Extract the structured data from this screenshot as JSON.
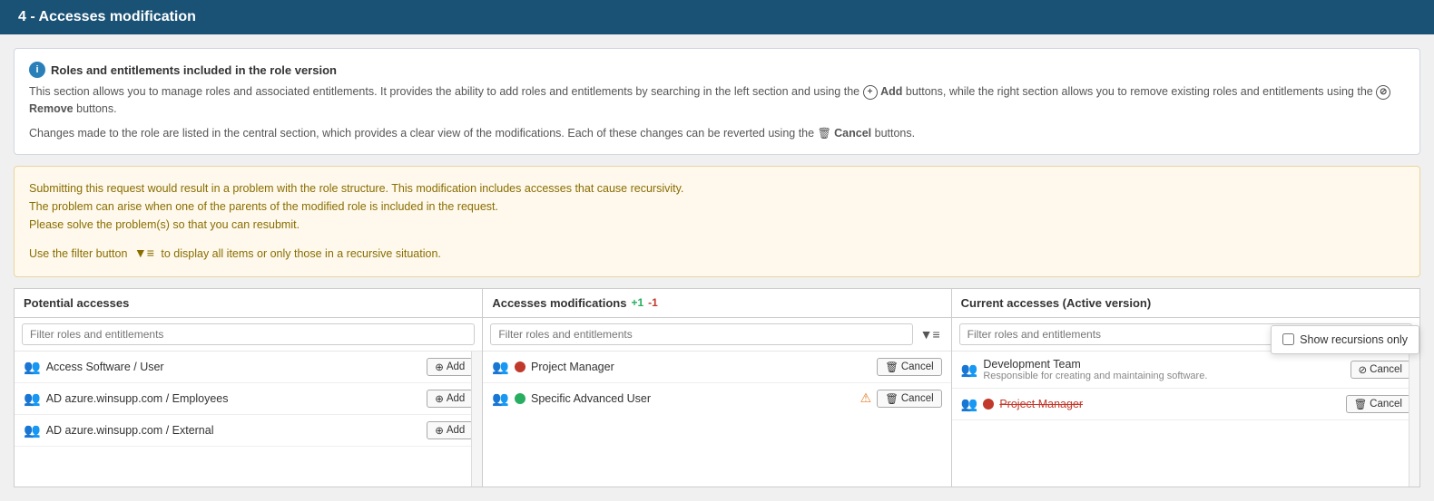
{
  "header": {
    "title": "4 - Accesses modification"
  },
  "info_box": {
    "title": "Roles and entitlements included in the role version",
    "line1": "This section allows you to manage roles and associated entitlements. It provides the ability to add roles and entitlements by searching in the left section and using the",
    "add_label": "Add",
    "line2": "buttons, while the right section allows you to remove existing roles and entitlements using the",
    "remove_label": "Remove",
    "line3": "buttons.",
    "line4": "Changes made to the role are listed in the central section, which provides a clear view of the modifications. Each of these changes can be reverted using the",
    "cancel_label": "Cancel",
    "line5": "buttons."
  },
  "warning_box": {
    "line1": "Submitting this request would result in a problem with the role structure. This modification includes accesses that cause recursivity.",
    "line2": "The problem can arise when one of the parents of the modified role is included in the request.",
    "line3": "Please solve the problem(s) so that you can resubmit.",
    "filter_line": "Use the filter button",
    "filter_line2": "to display all items or only those in a recursive situation."
  },
  "potential_accesses": {
    "title": "Potential accesses",
    "filter_placeholder": "Filter roles and entitlements",
    "rows": [
      {
        "name": "Access Software / User",
        "btn": "Add"
      },
      {
        "name": "AD azure.winsupp.com / Employees",
        "btn": "Add"
      },
      {
        "name": "AD azure.winsupp.com / External",
        "btn": "Add"
      }
    ]
  },
  "accesses_modifications": {
    "title": "Accesses modifications",
    "badge_add": "+1",
    "badge_remove": "-1",
    "filter_placeholder": "Filter roles and entitlements",
    "rows": [
      {
        "name": "Project Manager",
        "status": "red",
        "btn": "Cancel"
      },
      {
        "name": "Specific Advanced User",
        "status": "green",
        "btn": "Cancel",
        "warning": true
      }
    ]
  },
  "current_accesses": {
    "title": "Current accesses (Active version)",
    "filter_placeholder": "Filter roles and entitlements",
    "dropdown_label": "Show recursions only",
    "rows": [
      {
        "name": "Development Team",
        "sub": "Responsible for creating and maintaining software.",
        "btn": "Remove"
      },
      {
        "name": "Project Manager",
        "status": "red",
        "strikethrough": true,
        "btn": "Cancel"
      }
    ]
  },
  "buttons": {
    "add": "Add",
    "cancel": "Cancel",
    "remove": "Remove"
  },
  "icons": {
    "info": "i",
    "add_circle": "⊕",
    "remove_circle": "⊘",
    "cancel_trash": "🗑",
    "filter": "▼≡",
    "users": "👥",
    "warning_triangle": "⚠"
  }
}
